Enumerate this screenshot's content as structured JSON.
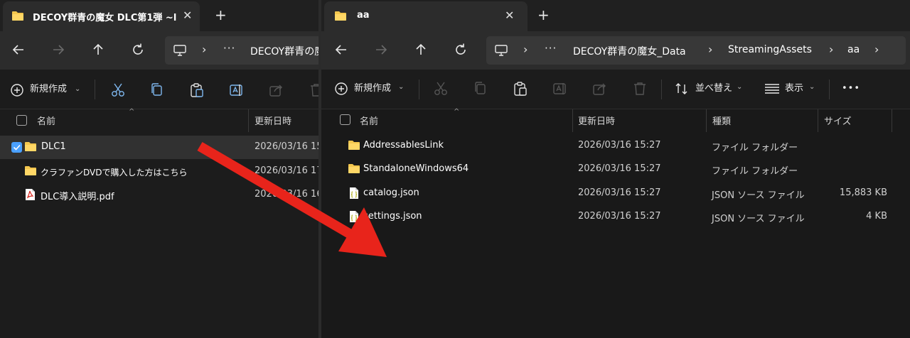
{
  "left_window": {
    "tab_title": "DECOY群青の魔女 DLC第1弾 ~l",
    "tab_close": "✕",
    "new_tab": "+",
    "address_crumbs": [
      "DECOY群青の魔"
    ],
    "toolbar": {
      "new_label": "新規作成"
    },
    "columns": {
      "name": "名前",
      "date": "更新日時"
    },
    "rows": [
      {
        "name": "DLC1",
        "date": "2026/03/16 15",
        "icon": "folder-icon",
        "selected": true
      },
      {
        "name": "クラファンDVDで購入した方はこちら",
        "date": "2026/03/16 17",
        "icon": "folder-icon",
        "selected": false
      },
      {
        "name": "DLC導入説明.pdf",
        "date": "2026/03/16 16",
        "icon": "pdf-icon",
        "selected": false
      }
    ]
  },
  "right_window": {
    "tab_title": "aa",
    "tab_close": "✕",
    "new_tab": "+",
    "address_crumbs": [
      "DECOY群青の魔女_Data",
      "StreamingAssets",
      "aa"
    ],
    "toolbar": {
      "new_label": "新規作成",
      "sort_label": "並べ替え",
      "view_label": "表示",
      "more_label": "•••"
    },
    "columns": {
      "name": "名前",
      "date": "更新日時",
      "type": "種類",
      "size": "サイズ"
    },
    "rows": [
      {
        "name": "AddressablesLink",
        "date": "2026/03/16 15:27",
        "type": "ファイル フォルダー",
        "size": "",
        "icon": "folder-icon"
      },
      {
        "name": "StandaloneWindows64",
        "date": "2026/03/16 15:27",
        "type": "ファイル フォルダー",
        "size": "",
        "icon": "folder-icon"
      },
      {
        "name": "catalog.json",
        "date": "2026/03/16 15:27",
        "type": "JSON ソース ファイル",
        "size": "15,883 KB",
        "icon": "json-file-icon"
      },
      {
        "name": "settings.json",
        "date": "2026/03/16 15:27",
        "type": "JSON ソース ファイル",
        "size": "4 KB",
        "icon": "json-file-icon"
      }
    ]
  },
  "colors": {
    "arrow": "#e8241b",
    "folder": "#f4c74e",
    "accent": "#4aa0ff"
  }
}
